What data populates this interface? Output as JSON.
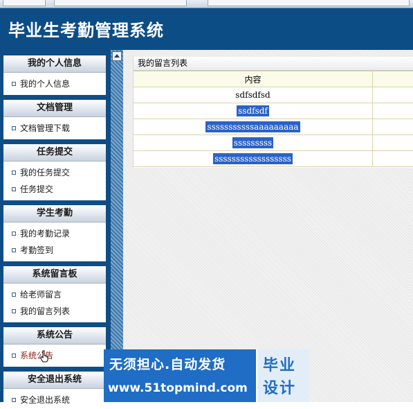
{
  "header": {
    "title": "毕业生考勤管理系统"
  },
  "sidebar": {
    "sections": [
      {
        "title": "我的个人信息",
        "items": [
          "我的个人信息"
        ]
      },
      {
        "title": "文档管理",
        "items": [
          "文档管理下载"
        ]
      },
      {
        "title": "任务提交",
        "items": [
          "我的任务提交",
          "任务提交"
        ]
      },
      {
        "title": "学生考勤",
        "items": [
          "我的考勤记录",
          "考勤签到"
        ]
      },
      {
        "title": "系统留言板",
        "items": [
          "给老师留言",
          "我的留言列表"
        ]
      },
      {
        "title": "系统公告",
        "items": [
          "系统公告"
        ]
      },
      {
        "title": "安全退出系统",
        "items": [
          "安全退出系统"
        ]
      }
    ]
  },
  "main": {
    "panel_title": "我的留言列表",
    "table": {
      "columns": [
        "内容",
        ""
      ],
      "rows": [
        "sdfsdfsd",
        "ssdfsdf",
        "sssssssssssaaaaaaaaa",
        "sssssssss",
        "ssssssssssssssssss"
      ]
    }
  },
  "ad": {
    "line1": "无须担心.自动发货",
    "line2": "www.51topmind.com",
    "brand_line1": "毕业",
    "brand_line2": "设计"
  },
  "colors": {
    "header_bg": "#0d4d86",
    "selection": "#2a62c9",
    "ad_blue": "#1f6dc4"
  }
}
